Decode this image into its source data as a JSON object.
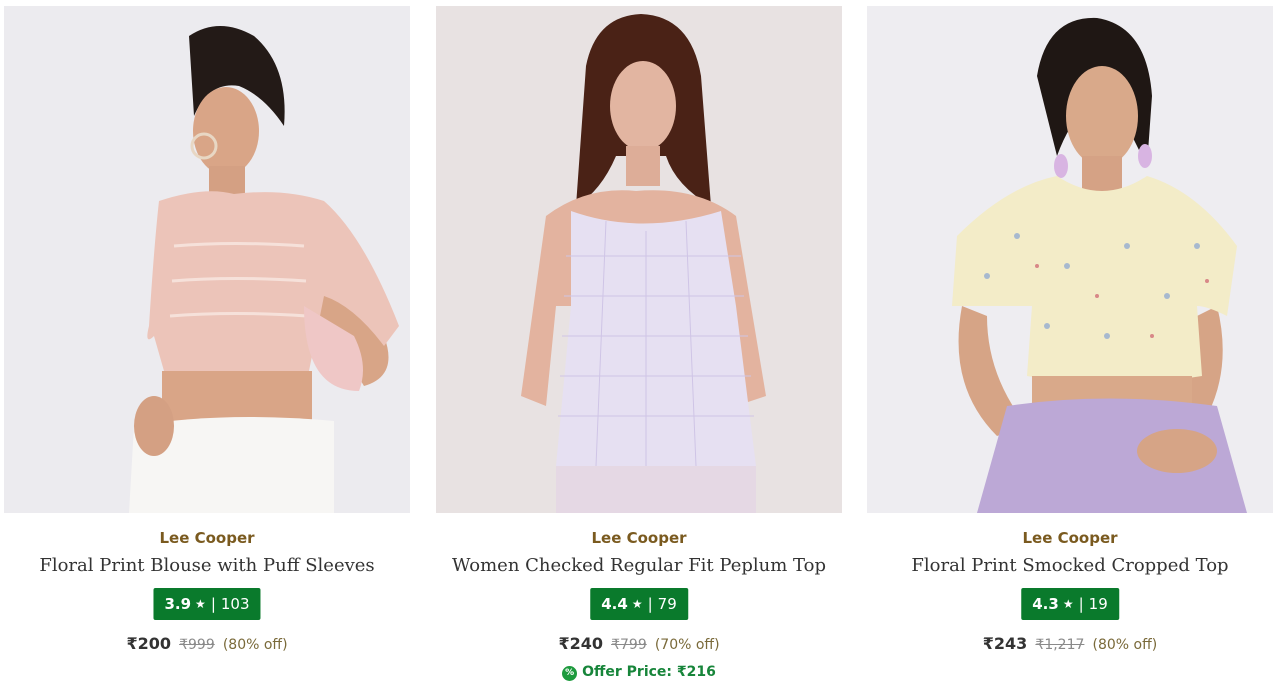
{
  "products": [
    {
      "brand": "Lee Cooper",
      "title": "Floral Print Blouse with Puff Sleeves",
      "rating": "3.9",
      "reviews": "103",
      "price": "₹200",
      "mrp": "₹999",
      "discount": "(80% off)",
      "image_bg": "#ecebef",
      "garment_color": "#ecc4b9"
    },
    {
      "brand": "Lee Cooper",
      "title": "Women Checked Regular Fit Peplum Top",
      "rating": "4.4",
      "reviews": "79",
      "price": "₹240",
      "mrp": "₹799",
      "discount": "(70% off)",
      "offer_icon": "%",
      "offer_text": "Offer Price: ₹216",
      "image_bg": "#e8e2e2",
      "garment_color": "#e6e0f2"
    },
    {
      "brand": "Lee Cooper",
      "title": "Floral Print Smocked Cropped Top",
      "rating": "4.3",
      "reviews": "19",
      "price": "₹243",
      "mrp": "₹1,217",
      "discount": "(80% off)",
      "image_bg": "#eeedf1",
      "garment_color": "#f3ecc8"
    }
  ],
  "rating_star": "★",
  "rating_separator": "|",
  "colors": {
    "brand_text": "#7a5a1f",
    "rating_badge": "#0a7a2c",
    "offer_green": "#17853a"
  }
}
